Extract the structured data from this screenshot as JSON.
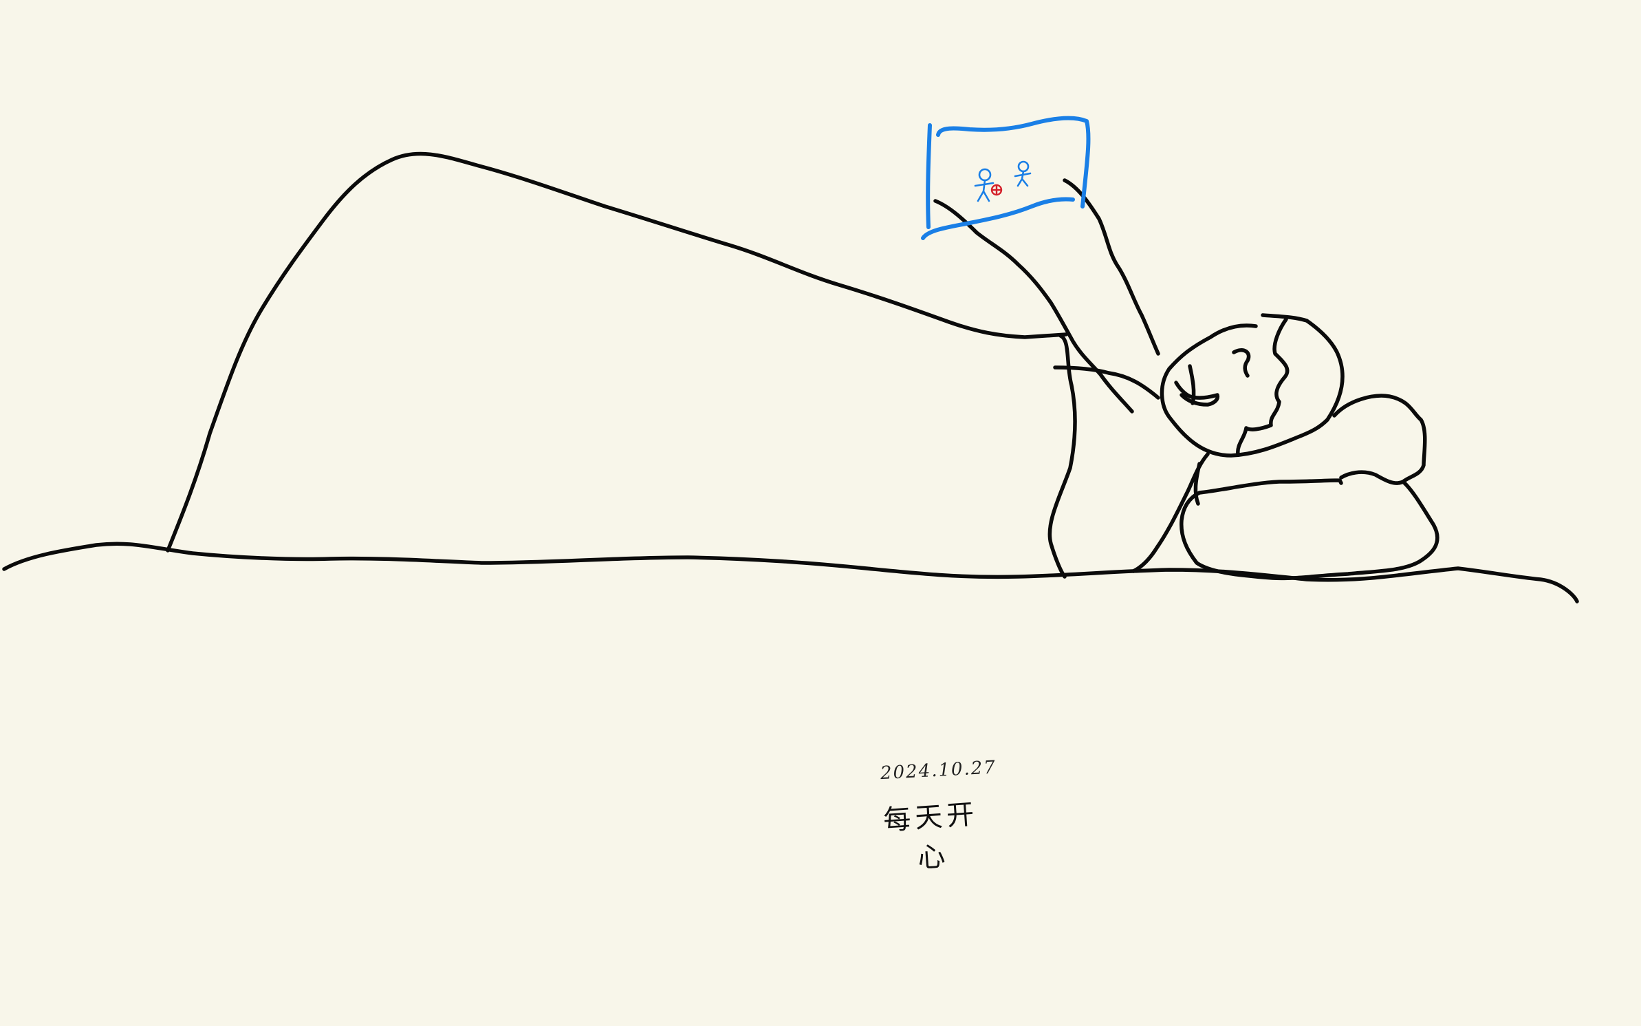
{
  "drawing": {
    "date": "2024.10.27",
    "note": "每天开心",
    "ink_color": "#0b0b0b",
    "frame_color": "#1a7fe6",
    "ball_color": "#d4202a",
    "background_color": "#f8f6ea"
  }
}
